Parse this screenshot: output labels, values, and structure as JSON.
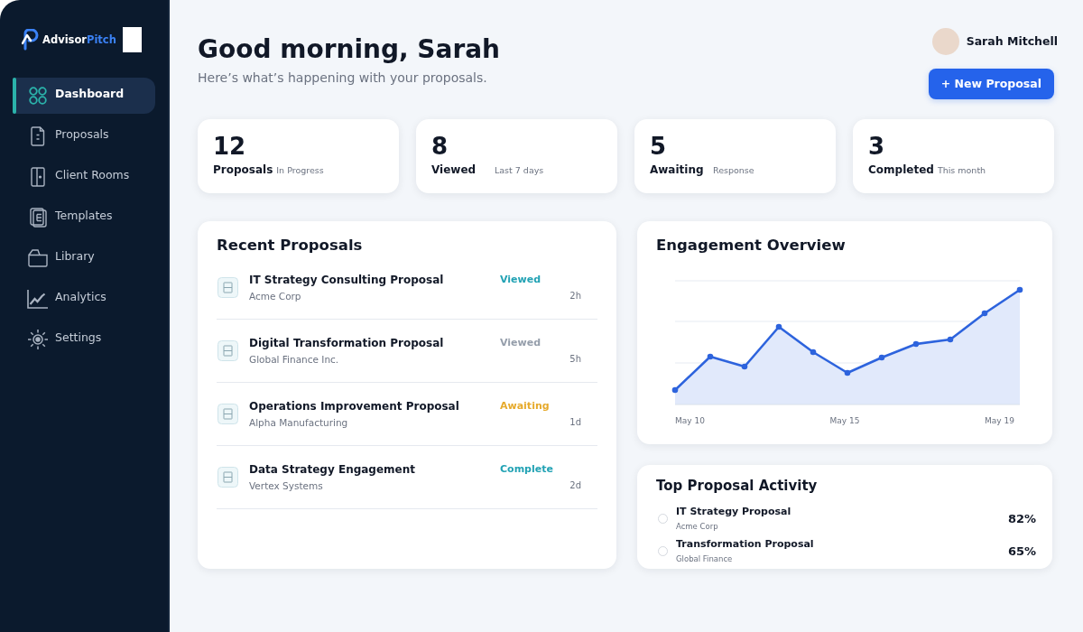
{
  "sidebar": {
    "logo": {
      "name_main": "Advisor",
      "name_accent": "Pitch"
    },
    "items": [
      {
        "label": "Dashboard",
        "selected": true
      },
      {
        "label": "Proposals",
        "selected": false
      },
      {
        "label": "Client Rooms",
        "selected": false
      },
      {
        "label": "Templates",
        "selected": false
      },
      {
        "label": "Library",
        "selected": false
      },
      {
        "label": "Analytics",
        "selected": false
      },
      {
        "label": "Settings",
        "selected": false
      }
    ]
  },
  "header": {
    "greeting": "Good morning, Sarah",
    "subtitle": "Here’s what’s happening with your proposals."
  },
  "user": {
    "name": "Sarah Mitchell"
  },
  "new_proposal_button": "+ New Proposal",
  "stats": [
    {
      "value": "12",
      "label": "Proposals",
      "note": "In Progress"
    },
    {
      "value": "8",
      "label": "Viewed",
      "note": "Last 7 days"
    },
    {
      "value": "5",
      "label": "Awaiting",
      "note": "Response"
    },
    {
      "value": "3",
      "label": "Completed",
      "note": "This month"
    }
  ],
  "recent_proposals": {
    "title": "Recent Proposals",
    "rows": [
      {
        "title": "IT Strategy Consulting Proposal",
        "client": "Acme Corp",
        "status": "Viewed",
        "color": "#22a2b4",
        "time": "2h"
      },
      {
        "title": "Digital Transformation Proposal",
        "client": "Global Finance Inc.",
        "status": "Viewed",
        "color": "#959eab",
        "time": "5h"
      },
      {
        "title": "Operations Improvement Proposal",
        "client": "Alpha Manufacturing",
        "status": "Awaiting",
        "color": "#e6aa2c",
        "time": "1d"
      },
      {
        "title": "Data Strategy Engagement",
        "client": "Vertex Systems",
        "status": "Complete",
        "color": "#22a2b4",
        "time": "2d"
      }
    ]
  },
  "engagement": {
    "title": "Engagement Overview",
    "x_labels": [
      "May 10",
      "May 15",
      "May 19"
    ]
  },
  "top_activity": {
    "title": "Top Proposal Activity",
    "rows": [
      {
        "title": "IT Strategy Proposal",
        "client": "Acme Corp",
        "percent": "82%"
      },
      {
        "title": "Transformation Proposal",
        "client": "Global Finance",
        "percent": "65%"
      }
    ]
  }
}
